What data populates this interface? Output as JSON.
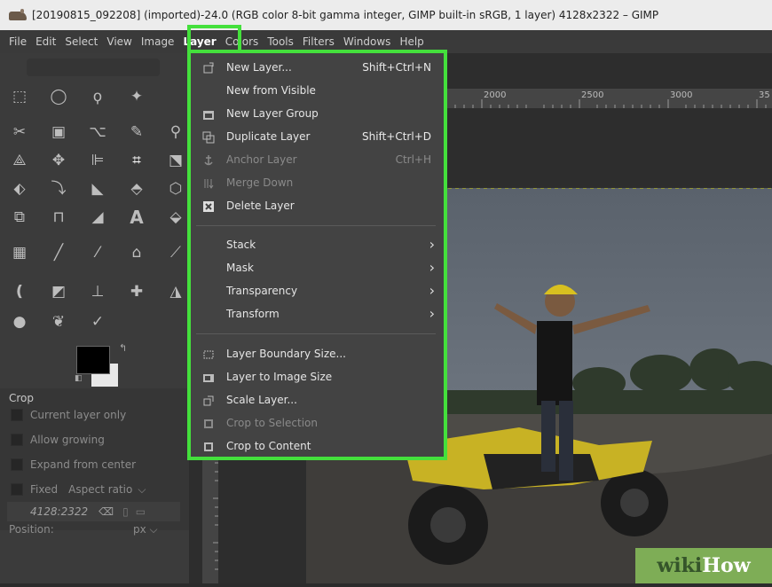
{
  "window": {
    "title": "[20190815_092208] (imported)-24.0 (RGB color 8-bit gamma integer, GIMP built-in sRGB, 1 layer) 4128x2322 – GIMP"
  },
  "menubar": {
    "items": [
      "File",
      "Edit",
      "Select",
      "View",
      "Image",
      "Layer",
      "Colors",
      "Tools",
      "Filters",
      "Windows",
      "Help"
    ],
    "active": "Layer"
  },
  "layer_menu": {
    "items": [
      {
        "label": "New Layer...",
        "shortcut": "Shift+Ctrl+N",
        "icon": "new-layer-icon",
        "enabled": true
      },
      {
        "label": "New from Visible",
        "shortcut": "",
        "icon": "",
        "enabled": true
      },
      {
        "label": "New Layer Group",
        "shortcut": "",
        "icon": "layer-group-icon",
        "enabled": true
      },
      {
        "label": "Duplicate Layer",
        "shortcut": "Shift+Ctrl+D",
        "icon": "duplicate-icon",
        "enabled": true
      },
      {
        "label": "Anchor Layer",
        "shortcut": "Ctrl+H",
        "icon": "anchor-icon",
        "enabled": false
      },
      {
        "label": "Merge Down",
        "shortcut": "",
        "icon": "merge-down-icon",
        "enabled": false
      },
      {
        "label": "Delete Layer",
        "shortcut": "",
        "icon": "delete-icon",
        "enabled": true
      },
      {
        "label": "Stack",
        "submenu": true,
        "enabled": true
      },
      {
        "label": "Mask",
        "submenu": true,
        "enabled": true
      },
      {
        "label": "Transparency",
        "submenu": true,
        "enabled": true
      },
      {
        "label": "Transform",
        "submenu": true,
        "enabled": true
      },
      {
        "label": "Layer Boundary Size...",
        "icon": "boundary-icon",
        "enabled": true
      },
      {
        "label": "Layer to Image Size",
        "icon": "to-image-icon",
        "enabled": true
      },
      {
        "label": "Scale Layer...",
        "icon": "scale-icon",
        "enabled": true
      },
      {
        "label": "Crop to Selection",
        "icon": "crop-icon",
        "enabled": false
      },
      {
        "label": "Crop to Content",
        "icon": "crop-icon",
        "enabled": true
      }
    ]
  },
  "tool_options": {
    "heading": "Crop",
    "current_layer_only": "Current layer only",
    "allow_growing": "Allow growing",
    "expand_from_center": "Expand from center",
    "fixed": "Fixed",
    "aspect_ratio": "Aspect ratio",
    "ratio_value": "4128:2322",
    "position_label": "Position:",
    "unit": "px"
  },
  "ruler": {
    "ticks": [
      "2000",
      "2500",
      "3000",
      "35"
    ]
  },
  "watermark": {
    "part1": "wiki",
    "part2": "How"
  },
  "colors": {
    "highlight": "#44e03c",
    "menu_bg": "#434343"
  }
}
